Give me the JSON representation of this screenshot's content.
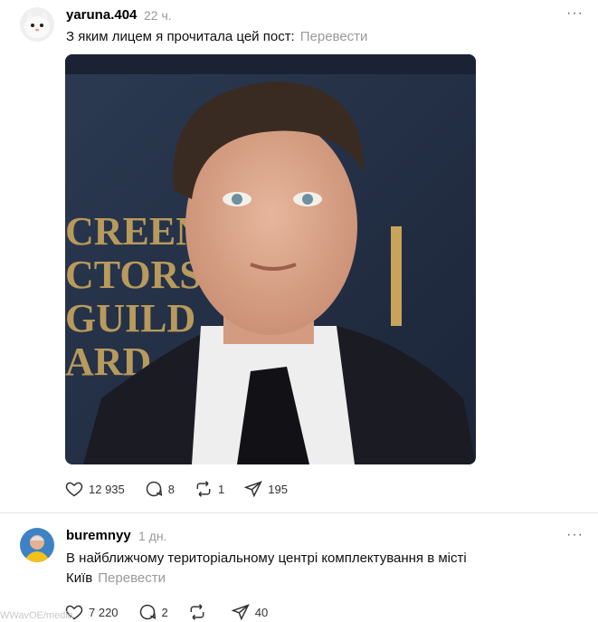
{
  "post1": {
    "username": "yaruna.404",
    "time": "22 ч.",
    "text": "З яким лицем я прочитала цей пост:",
    "translate": "Перевести",
    "likes": "12 935",
    "comments": "8",
    "reposts": "1",
    "shares": "195",
    "image_text": [
      "CREEN",
      "CTORS",
      "GUILD",
      "ARD"
    ]
  },
  "post2": {
    "username": "buremnyy",
    "time": "1 дн.",
    "text_line1": "В найближчому територіальному центрі комплектування в місті",
    "text_line2": "Київ",
    "translate": "Перевести",
    "likes": "7 220",
    "comments": "2",
    "shares": "40"
  },
  "more_label": "···",
  "watermark": "WWavOE/media"
}
